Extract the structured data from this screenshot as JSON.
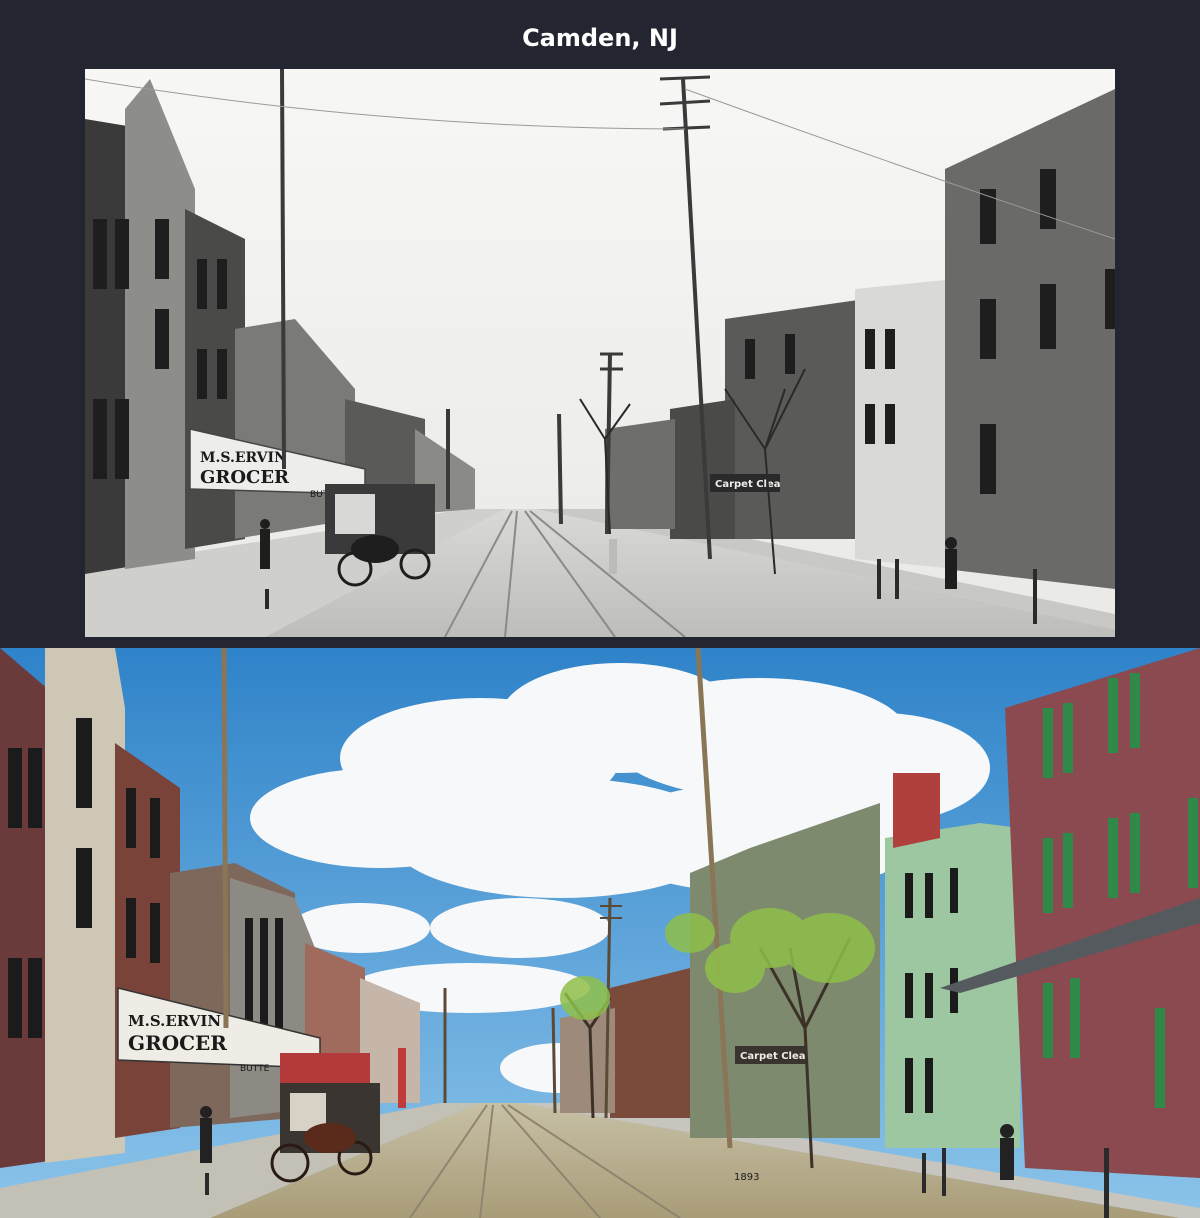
{
  "page": {
    "title": "Camden, NJ"
  },
  "photos": {
    "top": {
      "sign_line1": "M.S.ERVIN",
      "sign_line2": "GROCER",
      "butter_sign": "BUTTE",
      "carpet_sign": "Carpet Clea"
    },
    "bottom": {
      "sign_line1": "M.S.ERVIN",
      "sign_line2": "GROCER",
      "butter_sign": "BUTTE",
      "carpet_sign": "Carpet Clea",
      "year_caption": "1893"
    }
  },
  "colors": {
    "background": "#232630",
    "sky": "#3f8fd0",
    "brick": "#8a4a4f",
    "shutters": "#2f8a4a",
    "siding": "#9dc7a0"
  }
}
